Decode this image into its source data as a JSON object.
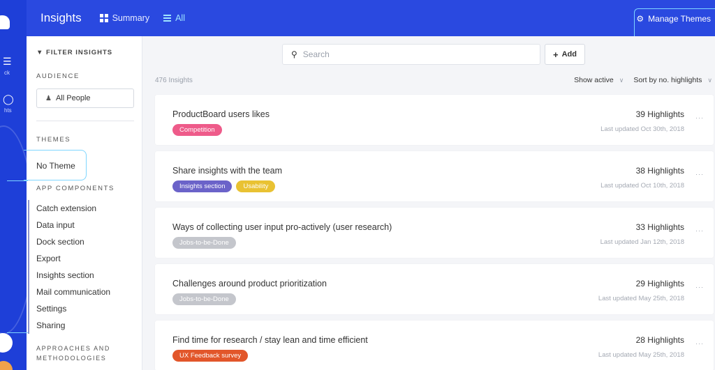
{
  "rail": {
    "label1": "ck",
    "label2": "hts"
  },
  "topbar": {
    "title": "Insights",
    "nav_summary": "Summary",
    "nav_all": "All",
    "manage_themes": "Manage Themes"
  },
  "sidebar": {
    "filter_heading": "FILTER INSIGHTS",
    "audience_heading": "AUDIENCE",
    "audience_value": "All People",
    "themes_heading": "THEMES",
    "no_theme": "No Theme",
    "app_components_heading": "APP COMPONENTS",
    "components": [
      "Catch extension",
      "Data input",
      "Dock section",
      "Export",
      "Insights section",
      "Mail communication",
      "Settings",
      "Sharing"
    ],
    "approaches_heading_line1": "APPROACHES AND",
    "approaches_heading_line2": "METHODOLOGIES"
  },
  "main": {
    "search_placeholder": "Search",
    "add_label": "Add",
    "count": "476 Insights",
    "show_active": "Show active",
    "sort_by": "Sort by no. highlights"
  },
  "insights": [
    {
      "title": "ProductBoard users likes",
      "tags": [
        {
          "label": "Competition",
          "color": "#ee5b8a"
        }
      ],
      "highlights": "39 Highlights",
      "updated": "Last updated Oct 30th, 2018"
    },
    {
      "title": "Share insights with the team",
      "tags": [
        {
          "label": "Insights section",
          "color": "#6b63c9"
        },
        {
          "label": "Usability",
          "color": "#e9c233"
        }
      ],
      "highlights": "38 Highlights",
      "updated": "Last updated Oct 10th, 2018"
    },
    {
      "title": "Ways of collecting user input pro-actively (user research)",
      "tags": [
        {
          "label": "Jobs-to-be-Done",
          "color": "#c4c6cc"
        }
      ],
      "highlights": "33 Highlights",
      "updated": "Last updated Jan 12th, 2018"
    },
    {
      "title": "Challenges around product prioritization",
      "tags": [
        {
          "label": "Jobs-to-be-Done",
          "color": "#c4c6cc"
        }
      ],
      "highlights": "29 Highlights",
      "updated": "Last updated May 25th, 2018"
    },
    {
      "title": "Find time for research / stay lean and time efficient",
      "tags": [
        {
          "label": "UX Feedback survey",
          "color": "#e2562a"
        }
      ],
      "highlights": "28 Highlights",
      "updated": "Last updated May 25th, 2018"
    }
  ],
  "icons": {
    "filter": "filter-icon",
    "person": "person-icon",
    "search": "search-icon",
    "plus": "plus-icon",
    "gear": "gear-icon",
    "chevron": "chevron-down-icon",
    "more": "more-icon"
  }
}
